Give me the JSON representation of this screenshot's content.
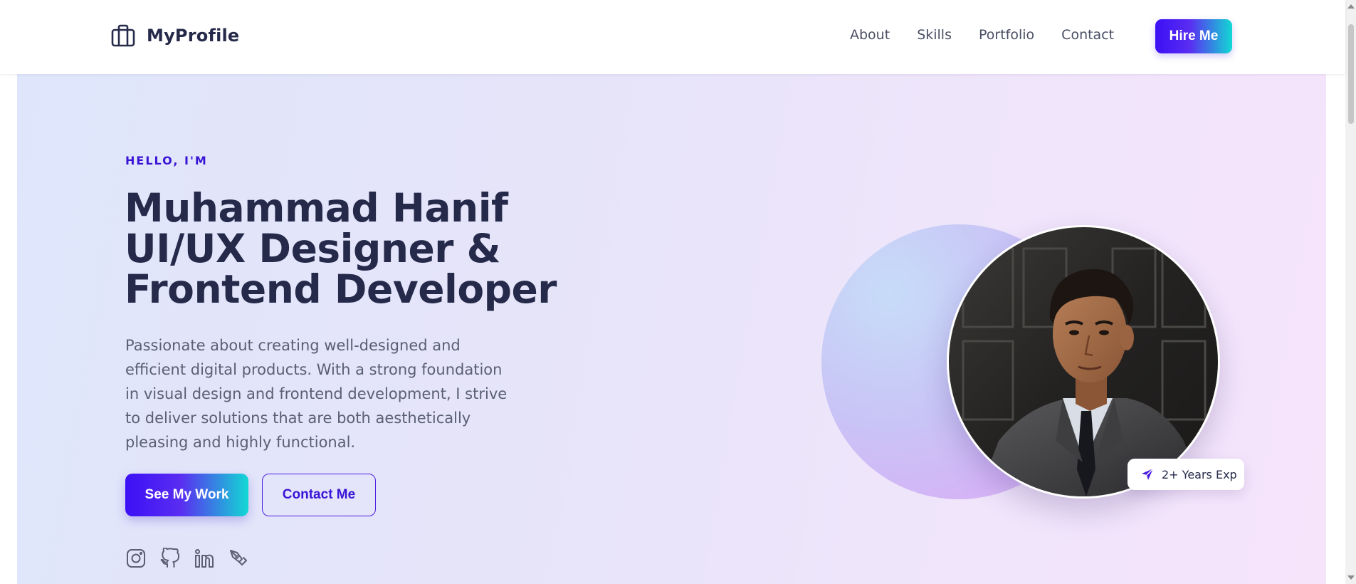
{
  "brand": {
    "name": "MyProfile",
    "icon": "briefcase-icon"
  },
  "nav": {
    "links": [
      "About",
      "Skills",
      "Portfolio",
      "Contact"
    ],
    "cta": "Hire Me"
  },
  "hero": {
    "greeting": "HELLO, I'M",
    "headline": [
      "Muhammad Hanif",
      "UI/UX Designer &",
      "Frontend Developer"
    ],
    "description": "Passionate about creating well-designed and efficient digital products. With a strong foundation in visual design and frontend development, I strive to deliver solutions that are both aesthetically pleasing and highly functional.",
    "primary_button": "See My Work",
    "secondary_button": "Contact Me",
    "socials": [
      "instagram-icon",
      "github-icon",
      "linkedin-icon",
      "pen-tool-icon"
    ],
    "experience_badge": "2+ Years Exp",
    "experience_icon": "send-icon"
  },
  "colors": {
    "accent": "#3a14d6",
    "gradient_start": "#3b10f5",
    "gradient_end": "#12d9d3",
    "text_dark": "#262a4a"
  }
}
